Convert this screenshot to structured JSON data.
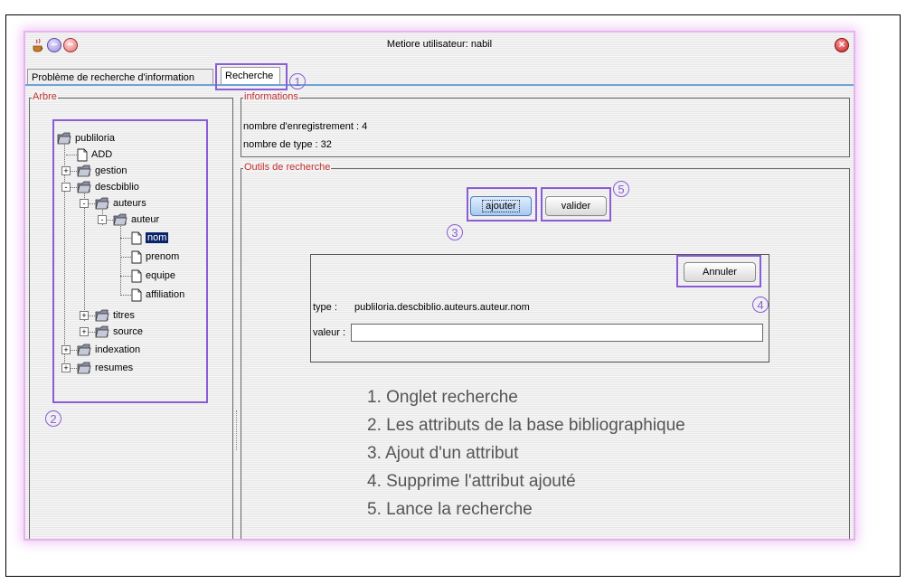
{
  "window": {
    "title": "Metiore utilisateur: nabil"
  },
  "tabs": [
    {
      "label": "Problème de recherche d'information"
    },
    {
      "label": "Recherche"
    }
  ],
  "left_panel": {
    "legend": "Arbre",
    "tree": [
      {
        "label": "publiloria",
        "icon": "folder-icon"
      },
      {
        "label": "ADD",
        "icon": "file-icon"
      },
      {
        "label": "gestion",
        "icon": "folder-icon"
      },
      {
        "label": "descbiblio",
        "icon": "folder-icon"
      },
      {
        "label": "auteurs",
        "icon": "folder-icon"
      },
      {
        "label": "auteur",
        "icon": "folder-icon"
      },
      {
        "label": "nom",
        "icon": "file-icon",
        "selected": true
      },
      {
        "label": "prenom",
        "icon": "file-icon"
      },
      {
        "label": "equipe",
        "icon": "file-icon"
      },
      {
        "label": "affiliation",
        "icon": "file-icon"
      },
      {
        "label": "titres",
        "icon": "folder-icon"
      },
      {
        "label": "source",
        "icon": "folder-icon"
      },
      {
        "label": "indexation",
        "icon": "folder-icon"
      },
      {
        "label": "resumes",
        "icon": "folder-icon"
      }
    ]
  },
  "informations": {
    "legend": "informations",
    "records": "nombre d'enregistrement : 4",
    "types": "nombre de type : 32"
  },
  "outils": {
    "legend": "Outils de recherche",
    "ajouter_label": "ajouter",
    "valider_label": "valider",
    "annuler_label": "Annuler",
    "type_label": "type :",
    "type_value": "publiloria.descbiblio.auteurs.auteur.nom",
    "valeur_label": "valeur :",
    "valeur_value": ""
  },
  "callouts": [
    "1",
    "2",
    "3",
    "4",
    "5"
  ],
  "legend_list": [
    "1. Onglet recherche",
    "2. Les attributs de la base bibliographique",
    "3. Ajout d'un attribut",
    "4. Supprime l'attribut ajouté",
    "5. Lance la recherche"
  ],
  "colors": {
    "callout": "#8a5cd6",
    "legend_text": "#c03030",
    "selection": "#0a246a",
    "tab_line": "#6fa3d6"
  }
}
